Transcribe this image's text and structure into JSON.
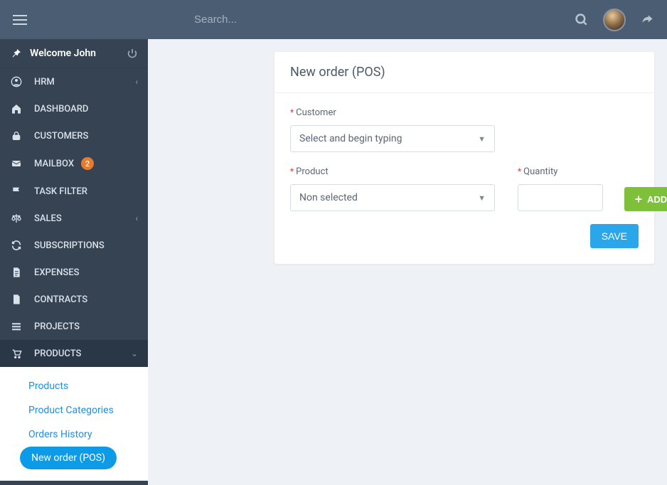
{
  "header": {
    "search_placeholder": "Search..."
  },
  "sidebar": {
    "welcome": "Welcome John",
    "items": [
      {
        "label": "HRM"
      },
      {
        "label": "DASHBOARD"
      },
      {
        "label": "CUSTOMERS"
      },
      {
        "label": "MAILBOX",
        "badge": "2"
      },
      {
        "label": "TASK FILTER"
      },
      {
        "label": "SALES"
      },
      {
        "label": "SUBSCRIPTIONS"
      },
      {
        "label": "EXPENSES"
      },
      {
        "label": "CONTRACTS"
      },
      {
        "label": "PROJECTS"
      },
      {
        "label": "PRODUCTS"
      }
    ],
    "sub": [
      {
        "label": "Products"
      },
      {
        "label": "Product Categories"
      },
      {
        "label": "Orders History"
      },
      {
        "label": "New order (POS)"
      }
    ]
  },
  "main": {
    "title": "New order (POS)",
    "customer_label": "Customer",
    "customer_selected": "Select and begin typing",
    "product_label": "Product",
    "product_selected": "Non selected",
    "quantity_label": "Quantity",
    "add_button": "ADD",
    "save_button": "SAVE"
  }
}
